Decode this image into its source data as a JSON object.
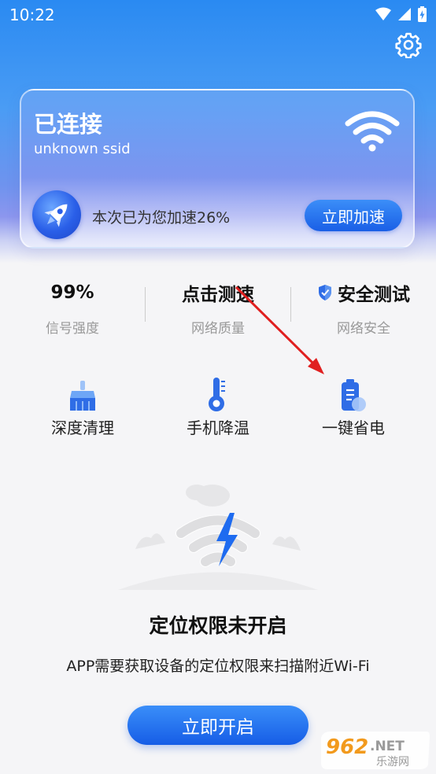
{
  "status_bar": {
    "time": "10:22"
  },
  "connection": {
    "status": "已连接",
    "ssid": "unknown ssid",
    "boost_text": "本次已为您加速26%",
    "boost_button": "立即加速"
  },
  "stats": [
    {
      "value": "99%",
      "label": "信号强度"
    },
    {
      "value": "点击测速",
      "label": "网络质量"
    },
    {
      "value": "安全测试",
      "label": "网络安全"
    }
  ],
  "tools": [
    {
      "label": "深度清理",
      "icon": "broom-icon"
    },
    {
      "label": "手机降温",
      "icon": "thermometer-icon"
    },
    {
      "label": "一键省电",
      "icon": "battery-icon"
    }
  ],
  "location": {
    "title": "定位权限未开启",
    "description": "APP需要获取设备的定位权限来扫描附近Wi-Fi",
    "button": "立即开启"
  },
  "watermark": {
    "number": "962",
    "suffix": ".NET",
    "site": "乐游网"
  },
  "colors": {
    "accent": "#1a5fe6",
    "arrow": "#e02020"
  }
}
